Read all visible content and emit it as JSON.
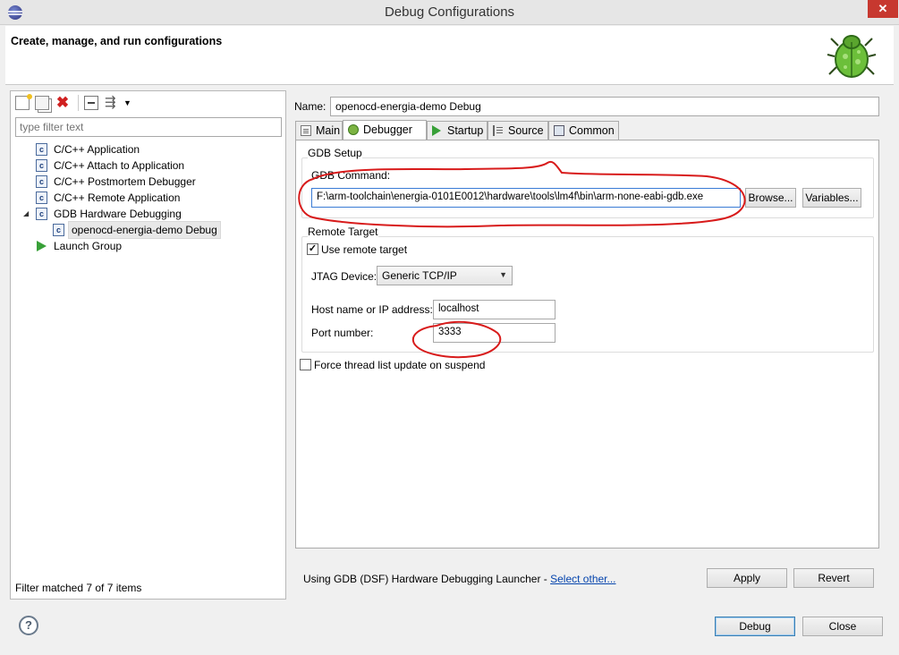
{
  "window": {
    "title": "Debug Configurations",
    "close_glyph": "✕"
  },
  "banner": {
    "title": "Create, manage, and run configurations",
    "icon": "bug-icon"
  },
  "left_panel": {
    "toolbar": {
      "new_icon": "new-config-icon",
      "duplicate_icon": "duplicate-icon",
      "delete_glyph": "✖",
      "collapse_icon": "collapse-all-icon",
      "filter_glyph": "⇶",
      "menu_glyph": "▼"
    },
    "filter_placeholder": "type filter text",
    "tree": [
      {
        "label": "C/C++ Application",
        "icon": "c-icon",
        "glyph": "c",
        "level": 0
      },
      {
        "label": "C/C++ Attach to Application",
        "icon": "c-icon",
        "glyph": "c",
        "level": 0
      },
      {
        "label": "C/C++ Postmortem Debugger",
        "icon": "c-icon",
        "glyph": "c",
        "level": 0
      },
      {
        "label": "C/C++ Remote Application",
        "icon": "c-icon",
        "glyph": "c",
        "level": 0
      },
      {
        "label": "GDB Hardware Debugging",
        "icon": "c-icon",
        "glyph": "c",
        "level": 0,
        "expanded": true,
        "twisty": "◢"
      },
      {
        "label": "openocd-energia-demo Debug",
        "icon": "c-icon",
        "glyph": "c",
        "level": 1,
        "selected": true
      },
      {
        "label": "Launch Group",
        "icon": "launch-icon",
        "level": 0
      }
    ],
    "filter_status": "Filter matched 7 of 7 items"
  },
  "config": {
    "name_label": "Name:",
    "name_value": "openocd-energia-demo Debug",
    "tabs": [
      {
        "label": "Main",
        "icon": "main-tab-icon"
      },
      {
        "label": "Debugger",
        "icon": "debugger-tab-icon",
        "active": true
      },
      {
        "label": "Startup",
        "icon": "startup-tab-icon"
      },
      {
        "label": "Source",
        "icon": "source-tab-icon"
      },
      {
        "label": "Common",
        "icon": "common-tab-icon"
      }
    ],
    "gdb_setup": {
      "group_label": "GDB Setup",
      "command_label": "GDB Command:",
      "command_value": "F:\\arm-toolchain\\energia-0101E0012\\hardware\\tools\\lm4f\\bin\\arm-none-eabi-gdb.exe",
      "browse_label": "Browse...",
      "variables_label": "Variables..."
    },
    "remote_target": {
      "group_label": "Remote Target",
      "use_remote_label": "Use remote target",
      "use_remote_checked": true,
      "check_glyph": "✓",
      "jtag_label": "JTAG Device:",
      "jtag_value": "Generic TCP/IP",
      "host_label": "Host name or IP address:",
      "host_value": "localhost",
      "port_label": "Port number:",
      "port_value": "3333"
    },
    "force_thread_label": "Force thread list update on suspend",
    "force_thread_checked": false,
    "launcher_text": "Using GDB (DSF) Hardware Debugging Launcher - ",
    "launcher_link": "Select other...",
    "apply_label": "Apply",
    "revert_label": "Revert"
  },
  "footer": {
    "help_glyph": "?",
    "debug_label": "Debug",
    "close_label": "Close"
  },
  "colors": {
    "annotation": "#d81b1b",
    "selection_border": "#3c7fb1",
    "link": "#0645ad"
  }
}
